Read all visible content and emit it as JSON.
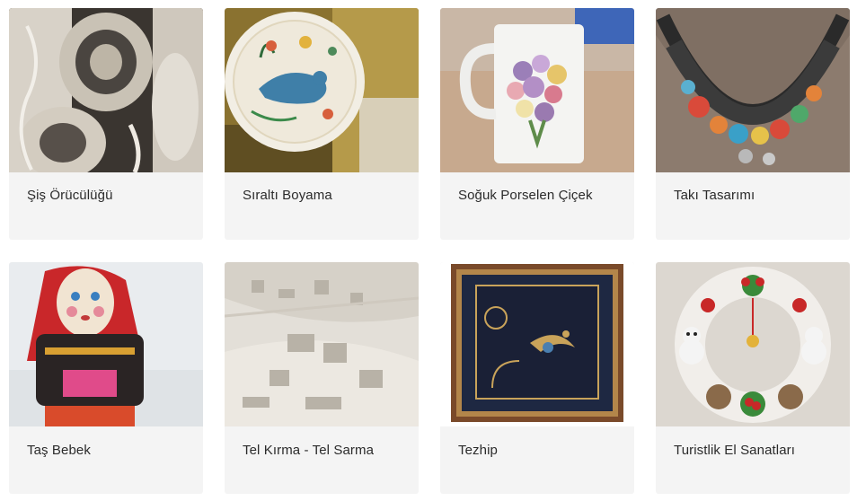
{
  "cards": [
    {
      "title": "Şiş Örücülüğü",
      "image": "lace-embroidery-photo"
    },
    {
      "title": "Sıraltı Boyama",
      "image": "painted-bird-plate-photo"
    },
    {
      "title": "Soğuk Porselen Çiçek",
      "image": "flower-mug-photo"
    },
    {
      "title": "Takı Tasarımı",
      "image": "beaded-necklace-photo"
    },
    {
      "title": "Taş Bebek",
      "image": "stone-doll-photo"
    },
    {
      "title": "Tel Kırma - Tel Sarma",
      "image": "wire-embroidered-cloth-photo"
    },
    {
      "title": "Tezhip",
      "image": "framed-illumination-photo"
    },
    {
      "title": "Turistlik El Sanatları",
      "image": "christmas-wreath-photo"
    }
  ]
}
